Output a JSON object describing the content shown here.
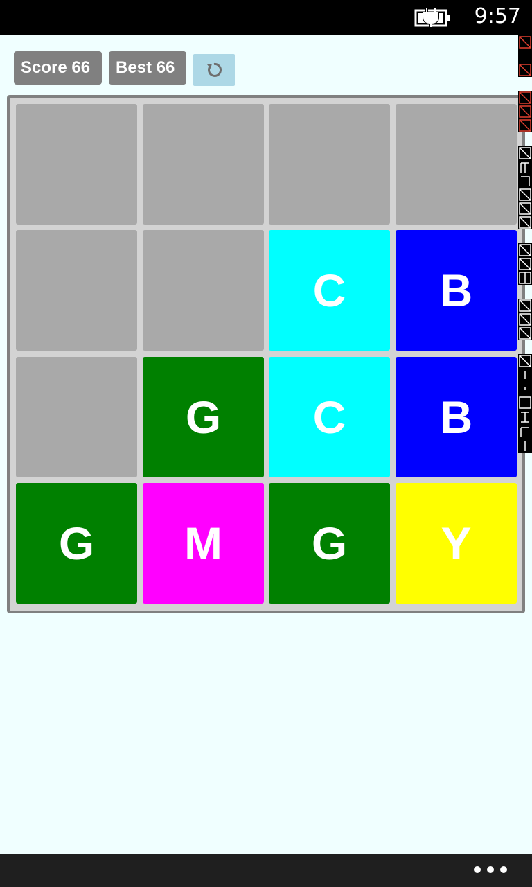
{
  "status_bar": {
    "time": "9:57",
    "battery_icon": "battery-charging-icon"
  },
  "header": {
    "score_label": "Score 66",
    "best_label": "Best 66",
    "restart_icon": "restart-icon",
    "restart_button_color": "#add8e6"
  },
  "board": {
    "rows": 4,
    "cols": 4,
    "tiles": [
      [
        {
          "letter": "",
          "color": "#a9a9a9"
        },
        {
          "letter": "",
          "color": "#a9a9a9"
        },
        {
          "letter": "",
          "color": "#a9a9a9"
        },
        {
          "letter": "",
          "color": "#a9a9a9"
        }
      ],
      [
        {
          "letter": "",
          "color": "#a9a9a9"
        },
        {
          "letter": "",
          "color": "#a9a9a9"
        },
        {
          "letter": "C",
          "color": "#00ffff"
        },
        {
          "letter": "B",
          "color": "#0000ff"
        }
      ],
      [
        {
          "letter": "",
          "color": "#a9a9a9"
        },
        {
          "letter": "G",
          "color": "#008000"
        },
        {
          "letter": "C",
          "color": "#00ffff"
        },
        {
          "letter": "B",
          "color": "#0000ff"
        }
      ],
      [
        {
          "letter": "G",
          "color": "#008000"
        },
        {
          "letter": "M",
          "color": "#ff00ff"
        },
        {
          "letter": "G",
          "color": "#008000"
        },
        {
          "letter": "Y",
          "color": "#ffff00"
        }
      ]
    ]
  },
  "app_bar": {
    "more_icon": "more-icon"
  }
}
